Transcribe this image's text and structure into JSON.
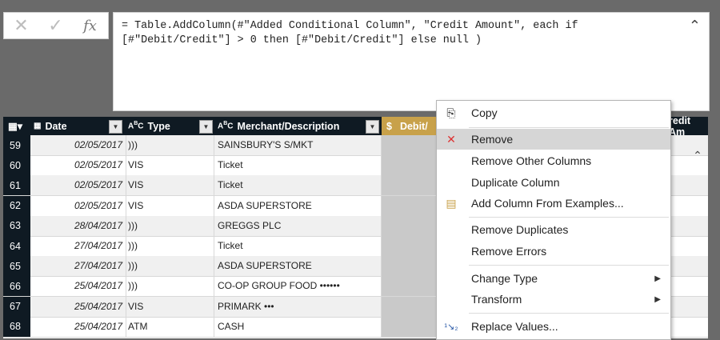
{
  "formula_bar": {
    "cancel_icon": "close-icon",
    "confirm_icon": "check-icon",
    "fx_label": "fx",
    "text": "= Table.AddColumn(#\"Added Conditional Column\", \"Credit Amount\", each if\n[#\"Debit/Credit\"] > 0 then [#\"Debit/Credit\"] else null )"
  },
  "grid": {
    "headers": {
      "date": "Date",
      "type": "Type",
      "merchant": "Merchant/Description",
      "debit": "Debit/",
      "credit": "redit Am"
    },
    "rows": [
      {
        "num": "59",
        "date": "02/05/2017",
        "type": ")))",
        "merchant": "SAINSBURY'S S/MKT"
      },
      {
        "num": "60",
        "date": "02/05/2017",
        "type": "VIS",
        "merchant": "Ticket"
      },
      {
        "num": "61",
        "date": "02/05/2017",
        "type": "VIS",
        "merchant": "Ticket"
      },
      {
        "num": "62",
        "date": "02/05/2017",
        "type": "VIS",
        "merchant": "ASDA SUPERSTORE"
      },
      {
        "num": "63",
        "date": "28/04/2017",
        "type": ")))",
        "merchant": "GREGGS PLC"
      },
      {
        "num": "64",
        "date": "27/04/2017",
        "type": ")))",
        "merchant": "Ticket"
      },
      {
        "num": "65",
        "date": "27/04/2017",
        "type": ")))",
        "merchant": "ASDA SUPERSTORE"
      },
      {
        "num": "66",
        "date": "25/04/2017",
        "type": ")))",
        "merchant": "CO-OP GROUP FOOD ••••••"
      },
      {
        "num": "67",
        "date": "25/04/2017",
        "type": "VIS",
        "merchant": "PRIMARK •••"
      },
      {
        "num": "68",
        "date": "25/04/2017",
        "type": "ATM",
        "merchant": "CASH"
      }
    ]
  },
  "context_menu": {
    "copy": "Copy",
    "remove": "Remove",
    "remove_other": "Remove Other Columns",
    "duplicate": "Duplicate Column",
    "add_from_examples": "Add Column From Examples...",
    "remove_duplicates": "Remove Duplicates",
    "remove_errors": "Remove Errors",
    "change_type": "Change Type",
    "transform": "Transform",
    "replace_values": "Replace Values..."
  }
}
